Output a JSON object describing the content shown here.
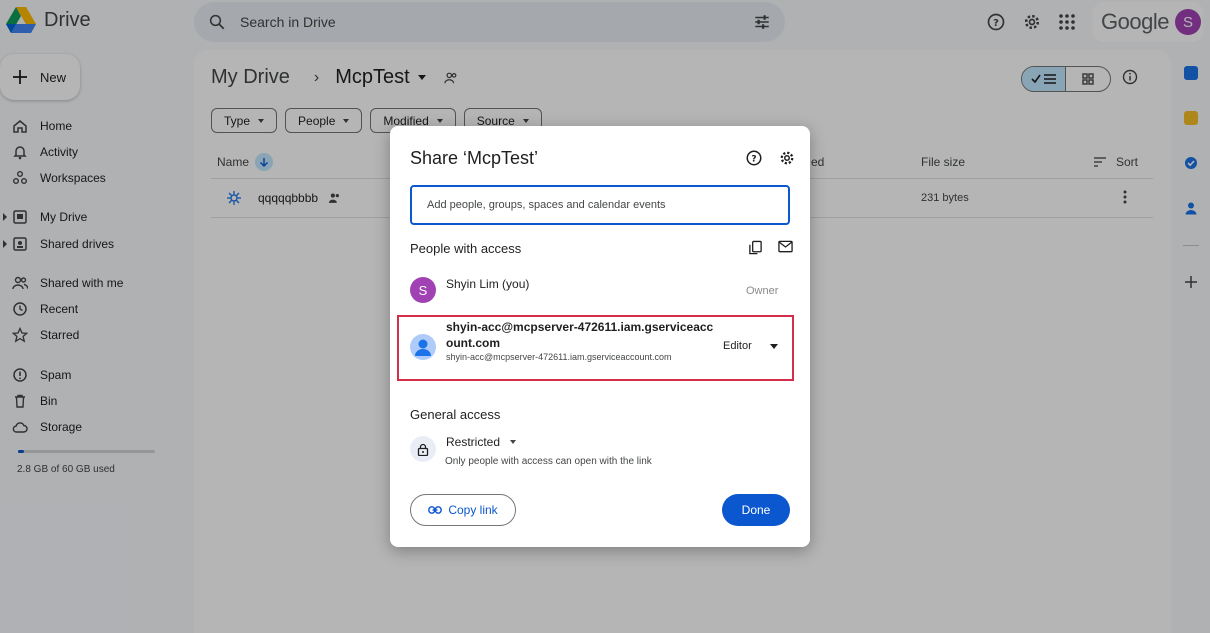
{
  "app": {
    "name": "Drive",
    "account_initial": "S",
    "google_wordmark": "Google"
  },
  "search": {
    "placeholder": "Search in Drive"
  },
  "sidebar": {
    "new_label": "New",
    "items": [
      {
        "label": "Home",
        "icon": "home-icon"
      },
      {
        "label": "Activity",
        "icon": "bell-icon"
      },
      {
        "label": "Workspaces",
        "icon": "workspaces-icon"
      },
      {
        "label": "My Drive",
        "icon": "my-drive-icon"
      },
      {
        "label": "Shared drives",
        "icon": "shared-drives-icon"
      },
      {
        "label": "Shared with me",
        "icon": "people-icon"
      },
      {
        "label": "Recent",
        "icon": "clock-icon"
      },
      {
        "label": "Starred",
        "icon": "star-icon"
      },
      {
        "label": "Spam",
        "icon": "spam-icon"
      },
      {
        "label": "Bin",
        "icon": "trash-icon"
      },
      {
        "label": "Storage",
        "icon": "cloud-icon"
      }
    ],
    "storage": {
      "text": "2.8 GB of 60 GB used",
      "used_fraction": 0.047
    }
  },
  "main": {
    "breadcrumb_root": "My Drive",
    "breadcrumb_sep": "›",
    "breadcrumb_current": "McpTest",
    "filters": [
      "Type",
      "People",
      "Modified",
      "Source"
    ],
    "columns": {
      "name": "Name",
      "modified_partial": "ed",
      "file_size": "File size",
      "sort": "Sort"
    },
    "rows": [
      {
        "name": "qqqqqbbbb",
        "size": "231 bytes"
      }
    ]
  },
  "dialog": {
    "title": "Share ‘McpTest’",
    "input_placeholder": "Add people, groups, spaces and calendar events",
    "people_heading": "People with access",
    "owner": {
      "initial": "S",
      "name": "Shyin Lim (you)",
      "role": "Owner"
    },
    "service_account": {
      "name": "shyin-acc@mcpserver-472611.iam.gserviceaccount.com",
      "email": "shyin-acc@mcpserver-472611.iam.gserviceaccount.com",
      "role": "Editor"
    },
    "general_heading": "General access",
    "general_value": "Restricted",
    "general_desc": "Only people with access can open with the link",
    "copy_link": "Copy link",
    "done": "Done"
  },
  "colors": {
    "accent": "#0b57d0",
    "highlight_box": "#d32f4a",
    "avatar": "#a142b4"
  }
}
